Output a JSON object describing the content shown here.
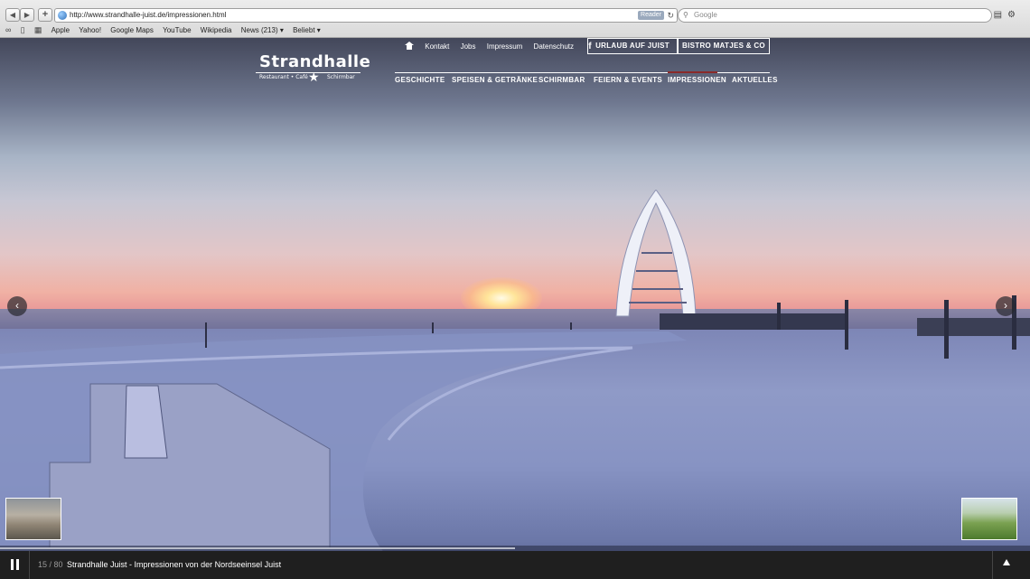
{
  "browser": {
    "url": "http://www.strandhalle-juist.de/impressionen.html",
    "reader_label": "Reader",
    "search_placeholder": "Google",
    "bookmarks": [
      "Apple",
      "Yahoo!",
      "Google Maps",
      "YouTube",
      "Wikipedia",
      "News (213) ▾",
      "Beliebt ▾"
    ]
  },
  "site": {
    "logo_name": "Strandhalle",
    "logo_sub_left": "Restaurant • Café",
    "logo_sub_right": "Schirmbar",
    "top_nav": [
      "Kontakt",
      "Jobs",
      "Impressum",
      "Datenschutz"
    ],
    "facebook_label": "f",
    "button1": "URLAUB AUF JUIST",
    "button2": "BISTRO MATJES & CO",
    "main_nav": [
      "GESCHICHTE",
      "SPEISEN & GETRÄNKE",
      "SCHIRMBAR",
      "FEIERN & EVENTS",
      "IMPRESSIONEN",
      "AKTUELLES"
    ],
    "active_nav": "IMPRESSIONEN"
  },
  "slider": {
    "counter": "15 / 80",
    "caption": "Strandhalle Juist - Impressionen von der Nordseeinsel Juist",
    "progress": 0.5
  },
  "icons": {
    "prev_arrow": "‹",
    "next_arrow": "›"
  }
}
